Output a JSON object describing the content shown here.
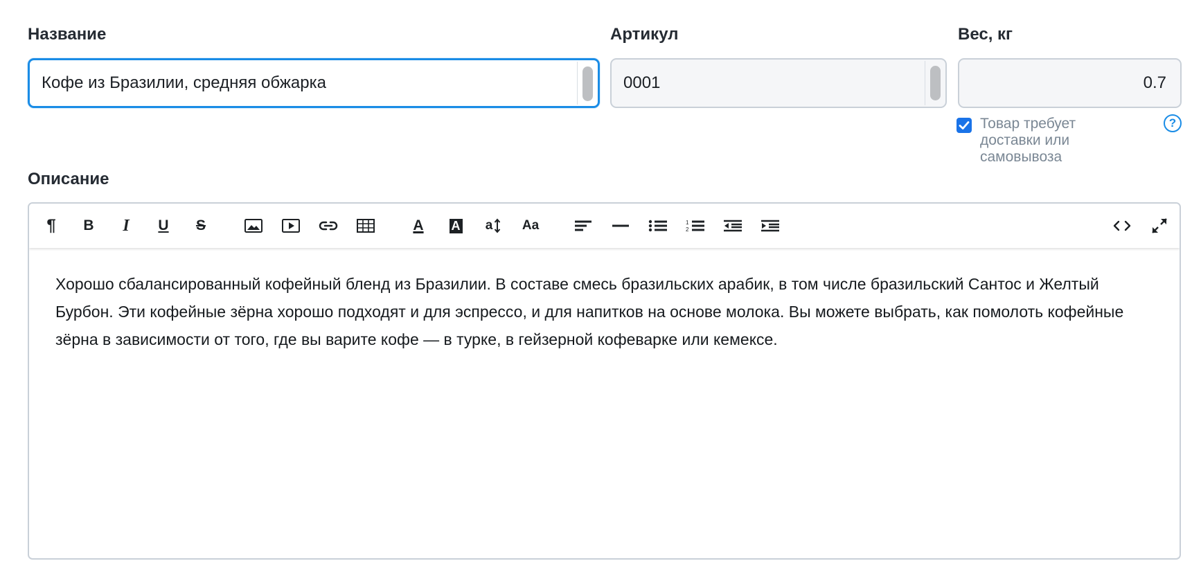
{
  "name_field": {
    "label": "Название",
    "value": "Кофе из Бразилии, средняя обжарка"
  },
  "sku_field": {
    "label": "Артикул",
    "value": "0001"
  },
  "weight_field": {
    "label": "Вес, кг",
    "value": "0.7"
  },
  "shipping": {
    "checked": true,
    "label": "Товар требует доставки или самовывоза",
    "help": "?"
  },
  "description": {
    "label": "Описание",
    "text": "Хорошо сбалансированный кофейный бленд из Бразилии. В составе смесь бразильских арабик, в том числе бразильский Сантос и Желтый Бурбон. Эти кофейные зёрна хорошо подходят и для эспрессо, и для напитков на основе молока. Вы можете выбрать, как помолоть кофейные зёрна в зависимости от того, где вы варите кофе — в турке, в гейзерной кофеварке или кемексе.",
    "toolbar": {
      "paragraph": "¶",
      "bold": "B",
      "italic": "I",
      "underline": "U",
      "strike": "S",
      "font_color": "A",
      "bg_color": "A",
      "font_size": "a",
      "font_family": "Aa",
      "icons": [
        "paragraph-icon",
        "bold-icon",
        "italic-icon",
        "underline-icon",
        "strikethrough-icon",
        "image-icon",
        "video-icon",
        "link-icon",
        "table-icon",
        "font-color-icon",
        "background-color-icon",
        "font-size-icon",
        "font-family-icon",
        "align-icon",
        "horizontal-rule-icon",
        "bulleted-list-icon",
        "numbered-list-icon",
        "outdent-icon",
        "indent-icon",
        "code-view-icon",
        "fullscreen-icon"
      ]
    }
  },
  "colors": {
    "accent": "#1a8ce6",
    "checkbox": "#1a73e8",
    "border": "#c9d0d8",
    "field_bg": "#f5f6f8",
    "muted_text": "#7a8794"
  }
}
